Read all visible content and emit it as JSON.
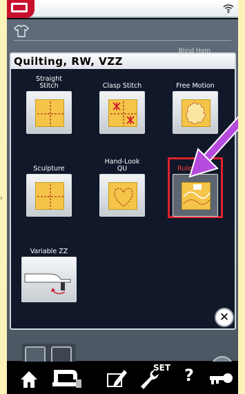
{
  "dialog": {
    "title": "Quilting, RW, VZZ",
    "background_item": "Blind Hem"
  },
  "stitches": [
    {
      "label": "Straight\nStitch",
      "icon": "straight-stitch-icon"
    },
    {
      "label": "Clasp Stitch",
      "icon": "clasp-stitch-icon"
    },
    {
      "label": "Free Motion",
      "icon": "free-motion-icon"
    },
    {
      "label": "Sculpture",
      "icon": "sculpture-icon"
    },
    {
      "label": "Hand-Look\nQU",
      "icon": "hand-look-quilting-icon"
    },
    {
      "label": "Ruler Work",
      "icon": "ruler-work-icon",
      "selected": true
    },
    {
      "label": "Variable ZZ",
      "icon": "variable-zz-icon"
    }
  ],
  "toolbar": {
    "set_label": "SET",
    "help_label": "?"
  },
  "colors": {
    "selection_red": "#e0232d",
    "tile_yellow": "#f5c54a",
    "annotation_purple": "#b44bdc",
    "panel_navy": "#10182a"
  }
}
